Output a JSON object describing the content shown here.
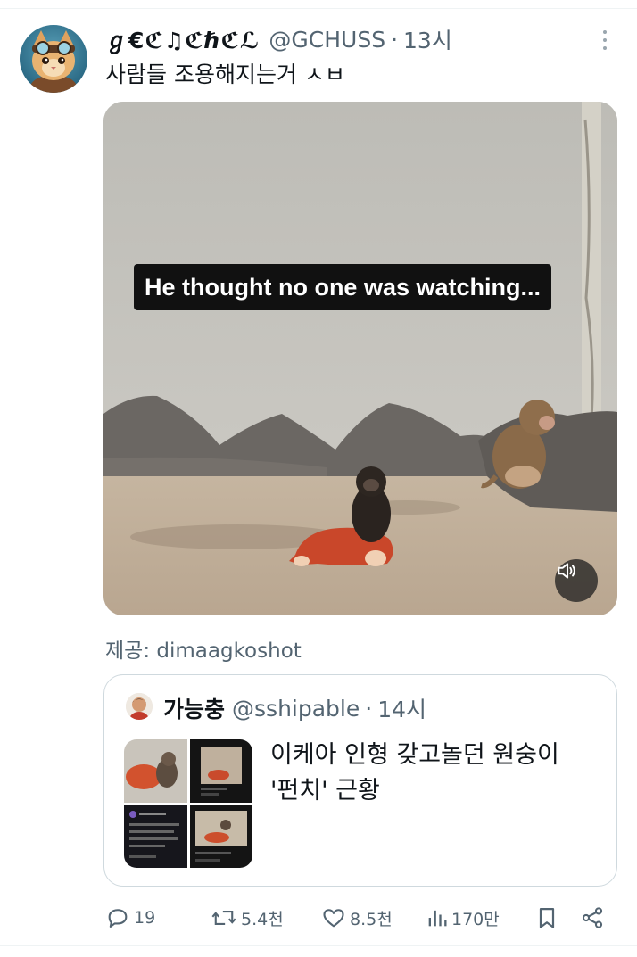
{
  "post": {
    "author_name": "ℊ€ℭ♫ℭℏℭℒ",
    "author_handle": "@GCHUSS",
    "separator": "·",
    "time": "13시",
    "text": "사람들 조용해지는거 ㅅㅂ",
    "video_caption": "He thought no one was watching...",
    "credit": "제공: dimaagkoshot"
  },
  "quoted_post": {
    "author_name": "가능충",
    "author_handle": "@sshipable",
    "separator": "·",
    "time": "14시",
    "text_line1": "이케아 인형 갖고놀던 원숭이",
    "text_line2": "'펀치' 근황"
  },
  "actions": {
    "replies": "19",
    "reposts": "5.4천",
    "likes": "8.5천",
    "views": "170만"
  },
  "icons": {
    "more": "more-vertical-icon",
    "sound": "speaker-icon",
    "reply": "reply-icon",
    "repost": "repost-icon",
    "like": "heart-icon",
    "views": "views-icon",
    "bookmark": "bookmark-icon",
    "share": "share-icon"
  },
  "colors": {
    "secondary_text": "#536471",
    "border": "#cfd9de"
  }
}
